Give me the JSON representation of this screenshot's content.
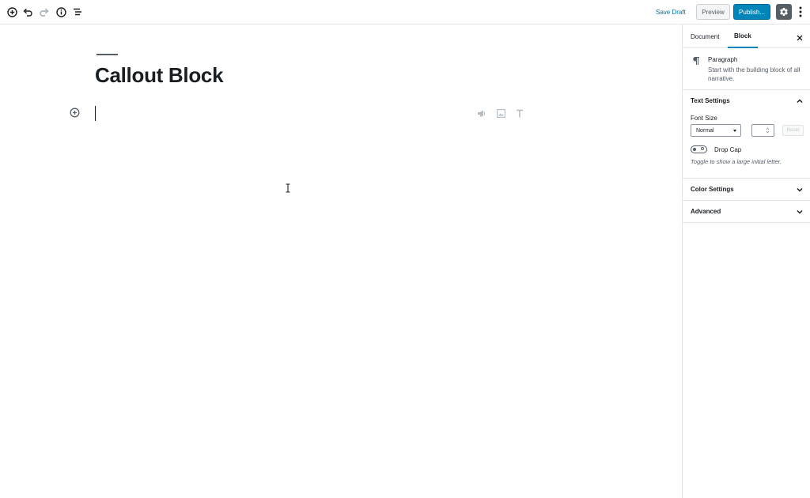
{
  "toolbar": {
    "save_draft": "Save Draft",
    "preview": "Preview",
    "publish": "Publish...",
    "icons": [
      "add-block-icon",
      "undo-icon",
      "redo-icon",
      "info-icon",
      "outline-icon",
      "gear-icon",
      "more-vertical-icon"
    ]
  },
  "editor": {
    "title": "Callout Block"
  },
  "sidebar": {
    "tabs": [
      {
        "label": "Document"
      },
      {
        "label": "Block"
      }
    ],
    "active_tab": "Block",
    "block": {
      "name": "Paragraph",
      "description": "Start with the building block of all narrative."
    },
    "panels": {
      "text_settings": {
        "title": "Text Settings",
        "font_size_label": "Font Size",
        "font_size_value": "Normal",
        "reset_label": "Reset",
        "drop_cap_label": "Drop Cap",
        "drop_cap_help": "Toggle to show a large initial letter."
      },
      "color_settings": {
        "title": "Color Settings"
      },
      "advanced": {
        "title": "Advanced"
      }
    }
  },
  "colors": {
    "accent": "#0085ba",
    "link": "#0073aa",
    "border": "#e2e4e7"
  }
}
